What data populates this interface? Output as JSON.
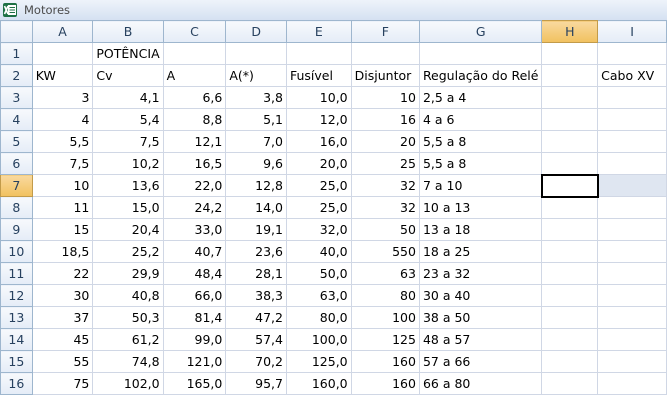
{
  "window": {
    "title": "Motores",
    "app_icon": "excel-icon"
  },
  "columns": [
    "A",
    "B",
    "C",
    "D",
    "E",
    "F",
    "G",
    "H",
    "I"
  ],
  "rows": [
    [
      "",
      "POTÊNCIA",
      "",
      "",
      "",
      "",
      "",
      "",
      ""
    ],
    [
      "KW",
      "Cv",
      "A",
      "A(*)",
      "Fusível",
      "Disjuntor",
      "Regulação do Relé",
      "",
      "Cabo XV"
    ],
    [
      "3",
      "4,1",
      "6,6",
      "3,8",
      "10,0",
      "10",
      "2,5 a 4",
      "",
      ""
    ],
    [
      "4",
      "5,4",
      "8,8",
      "5,1",
      "12,0",
      "16",
      "4 a 6",
      "",
      ""
    ],
    [
      "5,5",
      "7,5",
      "12,1",
      "7,0",
      "16,0",
      "20",
      "5,5 a 8",
      "",
      ""
    ],
    [
      "7,5",
      "10,2",
      "16,5",
      "9,6",
      "20,0",
      "25",
      "5,5 a 8",
      "",
      ""
    ],
    [
      "10",
      "13,6",
      "22,0",
      "12,8",
      "25,0",
      "32",
      "7 a 10",
      "",
      ""
    ],
    [
      "11",
      "15,0",
      "24,2",
      "14,0",
      "25,0",
      "32",
      "10 a 13",
      "",
      ""
    ],
    [
      "15",
      "20,4",
      "33,0",
      "19,1",
      "32,0",
      "50",
      "13 a 18",
      "",
      ""
    ],
    [
      "18,5",
      "25,2",
      "40,7",
      "23,6",
      "40,0",
      "550",
      "18 a 25",
      "",
      ""
    ],
    [
      "22",
      "29,9",
      "48,4",
      "28,1",
      "50,0",
      "63",
      "23 a 32",
      "",
      ""
    ],
    [
      "30",
      "40,8",
      "66,0",
      "38,3",
      "63,0",
      "80",
      "30 a 40",
      "",
      ""
    ],
    [
      "37",
      "50,3",
      "81,4",
      "47,2",
      "80,0",
      "100",
      "38 a 50",
      "",
      ""
    ],
    [
      "45",
      "61,2",
      "99,0",
      "57,4",
      "100,0",
      "125",
      "48 a 57",
      "",
      ""
    ],
    [
      "55",
      "74,8",
      "121,0",
      "70,2",
      "125,0",
      "160",
      "57 a 66",
      "",
      ""
    ],
    [
      "75",
      "102,0",
      "165,0",
      "95,7",
      "160,0",
      "160",
      "66 a 80",
      "",
      ""
    ]
  ],
  "selection": {
    "cell": "H7",
    "row": 7,
    "col": "H"
  }
}
